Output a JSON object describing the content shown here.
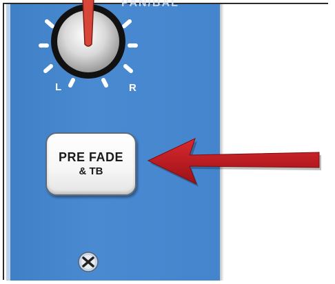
{
  "pan_section": {
    "title": "PAN/BAL",
    "left_label": "L",
    "right_label": "R"
  },
  "pfl_button": {
    "line1": "PRE FADE",
    "line2": "& TB"
  },
  "colors": {
    "strip_blue": "#4485cd",
    "arrow_red": "#c0191f",
    "knob_pointer": "#d8463a",
    "button_face": "#f7f7f7"
  },
  "icons": {
    "knob": "rotary-knob-icon",
    "arrow": "left-arrow-icon",
    "screw": "screw-icon"
  }
}
